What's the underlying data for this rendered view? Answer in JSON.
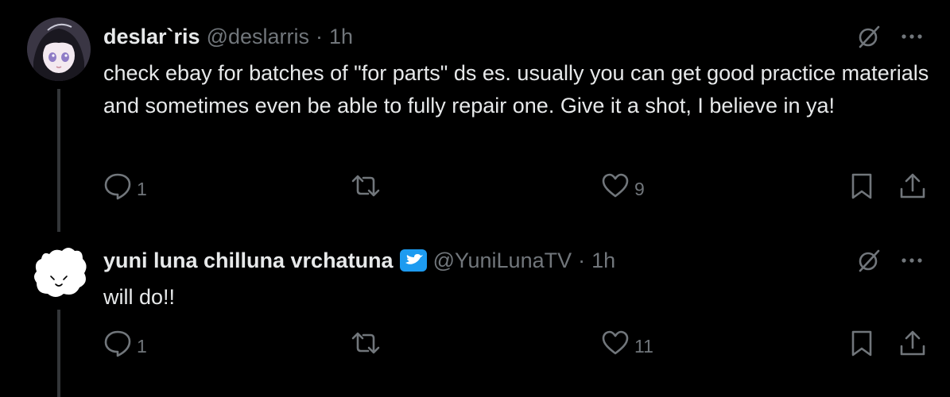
{
  "tweets": [
    {
      "display_name": "deslar`ris",
      "handle": "@deslarris",
      "separator": "·",
      "time": "1h",
      "verified": false,
      "text": "check ebay for batches of \"for parts\" ds es. usually you can get good practice materials and sometimes even be able to fully repair one. Give it a shot, I believe in ya!",
      "reply_count": "1",
      "retweet_count": "",
      "like_count": "9",
      "icons": [
        "grok-icon",
        "more-icon",
        "reply-icon",
        "retweet-icon",
        "like-icon",
        "bookmark-icon",
        "share-icon"
      ]
    },
    {
      "display_name": "yuni luna chilluna vrchatuna",
      "handle": "@YuniLunaTV",
      "separator": "·",
      "time": "1h",
      "verified": true,
      "text": "will do!!",
      "reply_count": "1",
      "retweet_count": "",
      "like_count": "11",
      "icons": [
        "grok-icon",
        "more-icon",
        "reply-icon",
        "retweet-icon",
        "like-icon",
        "bookmark-icon",
        "share-icon"
      ]
    }
  ],
  "colors": {
    "background": "#000000",
    "text": "#e7e9ea",
    "secondary": "#71767b",
    "thread_line": "#333639",
    "verified": "#1d9bf0"
  }
}
